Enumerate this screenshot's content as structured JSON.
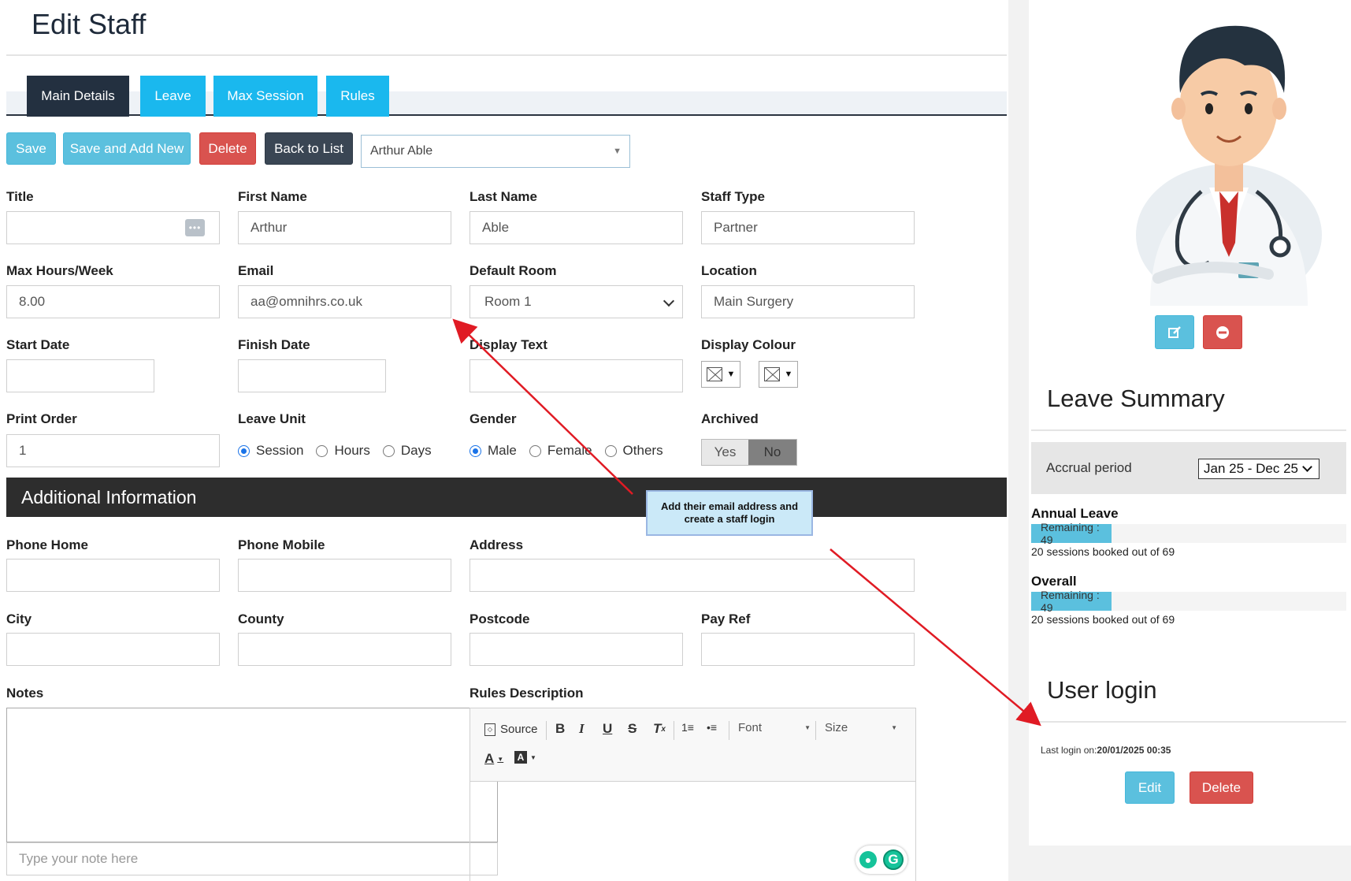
{
  "page": {
    "title": "Edit Staff"
  },
  "tabs": [
    {
      "label": "Main Details",
      "active": true
    },
    {
      "label": "Leave",
      "active": false
    },
    {
      "label": "Max Session",
      "active": false
    },
    {
      "label": "Rules",
      "active": false
    }
  ],
  "toolbar": {
    "save": "Save",
    "save_add_new": "Save and Add New",
    "delete": "Delete",
    "back_to_list": "Back to List",
    "staff_selector": "Arthur Able"
  },
  "form": {
    "title": {
      "label": "Title",
      "value": ""
    },
    "first_name": {
      "label": "First Name",
      "value": "Arthur"
    },
    "last_name": {
      "label": "Last Name",
      "value": "Able"
    },
    "staff_type": {
      "label": "Staff Type",
      "value": "Partner"
    },
    "max_hours": {
      "label": "Max Hours/Week",
      "value": "8.00"
    },
    "email": {
      "label": "Email",
      "value": "aa@omnihrs.co.uk"
    },
    "default_room": {
      "label": "Default Room",
      "value": "Room 1"
    },
    "location": {
      "label": "Location",
      "value": "Main Surgery"
    },
    "start_date": {
      "label": "Start Date",
      "value": ""
    },
    "finish_date": {
      "label": "Finish Date",
      "value": ""
    },
    "display_text": {
      "label": "Display Text",
      "value": ""
    },
    "display_colour": {
      "label": "Display Colour"
    },
    "print_order": {
      "label": "Print Order",
      "value": "1"
    },
    "leave_unit": {
      "label": "Leave Unit",
      "options": [
        "Session",
        "Hours",
        "Days"
      ],
      "selected": "Session"
    },
    "gender": {
      "label": "Gender",
      "options": [
        "Male",
        "Female",
        "Others"
      ],
      "selected": "Male"
    },
    "archived": {
      "label": "Archived",
      "yes": "Yes",
      "no": "No",
      "selected": "No"
    }
  },
  "additional": {
    "heading": "Additional Information",
    "phone_home": "Phone Home",
    "phone_mobile": "Phone Mobile",
    "address": "Address",
    "city": "City",
    "county": "County",
    "postcode": "Postcode",
    "pay_ref": "Pay Ref",
    "notes": "Notes",
    "note_placeholder": "Type your note here",
    "rules_description": "Rules Description"
  },
  "editor": {
    "source": "Source",
    "font": "Font",
    "size": "Size"
  },
  "callout": "Add their email address and create a staff login",
  "sidebar": {
    "leave_summary": "Leave Summary",
    "accrual_label": "Accrual period",
    "accrual_value": "Jan 25 - Dec 25",
    "annual_leave": {
      "title": "Annual Leave",
      "remaining": "Remaining : 49",
      "remaining_fraction": 0.255,
      "booked": "20 sessions booked out of 69"
    },
    "overall": {
      "title": "Overall",
      "remaining": "Remaining : 49",
      "remaining_fraction": 0.255,
      "booked": "20 sessions booked out of 69"
    },
    "user_login": "User login",
    "last_login_label": "Last login on:",
    "last_login_value": "20/01/2025 00:35",
    "edit": "Edit",
    "delete": "Delete"
  },
  "colors": {
    "tab_active": "#233040",
    "tab_inactive": "#1ab8ee",
    "info": "#5bc0de",
    "danger": "#d9534f",
    "dark": "#3a4654"
  }
}
